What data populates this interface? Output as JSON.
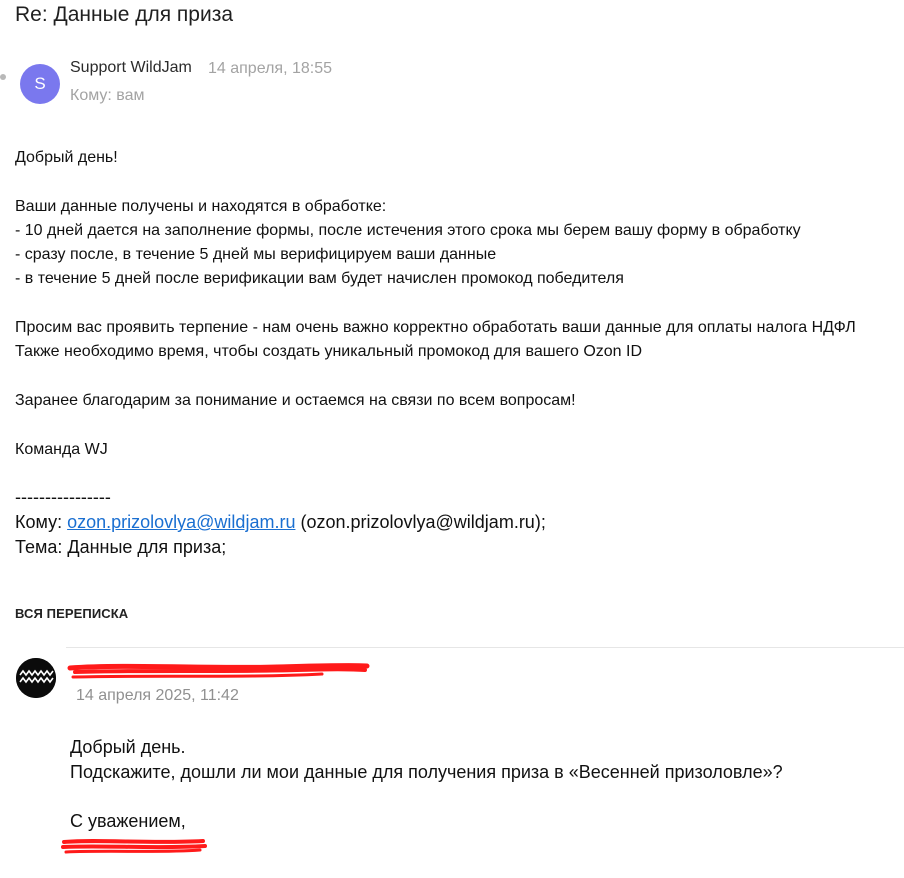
{
  "email": {
    "subject": "Re: Данные для приза",
    "sender": {
      "avatar_letter": "S",
      "name": "Support WildJam",
      "date": "14 апреля, 18:55",
      "recipient_prefix": "Кому:",
      "recipient": "вам"
    },
    "body": {
      "greeting": "Добрый день!",
      "intro": "Ваши данные получены и находятся в обработке:",
      "bullet1": "- 10 дней дается на заполнение формы, после истечения этого срока мы берем вашу форму в обработку",
      "bullet2": "- сразу после, в течение 5 дней мы верифицируем ваши данные",
      "bullet3": "- в течение 5 дней после верификации вам будет начислен промокод победителя",
      "patience1": "Просим вас проявить терпение - нам очень важно корректно обработать ваши данные для оплаты налога НДФЛ",
      "patience2": "Также необходимо время, чтобы создать уникальный промокод для вашего Ozon ID",
      "thanks": "Заранее благодарим за понимание и остаемся на связи по всем вопросам!",
      "signature": "Команда WJ"
    },
    "quoted": {
      "separator": "----------------",
      "to_label": "Кому:",
      "to_link": "ozon.prizolovlya@wildjam.ru",
      "to_plain": "(ozon.prizolovlya@wildjam.ru);",
      "subject_line": "Тема: Данные для приза;"
    }
  },
  "thread": {
    "label": "ВСЯ ПЕРЕПИСКА",
    "message": {
      "date": "14 апреля 2025, 11:42",
      "line1": "Добрый день.",
      "line2": "Подскажите, дошли ли мои данные для получения приза в «Весенней призоловле»?",
      "closing": "С уважением,"
    }
  },
  "colors": {
    "avatar_bg": "#7a78ee",
    "link": "#1a6fd1",
    "redaction": "#ff1a1a"
  }
}
